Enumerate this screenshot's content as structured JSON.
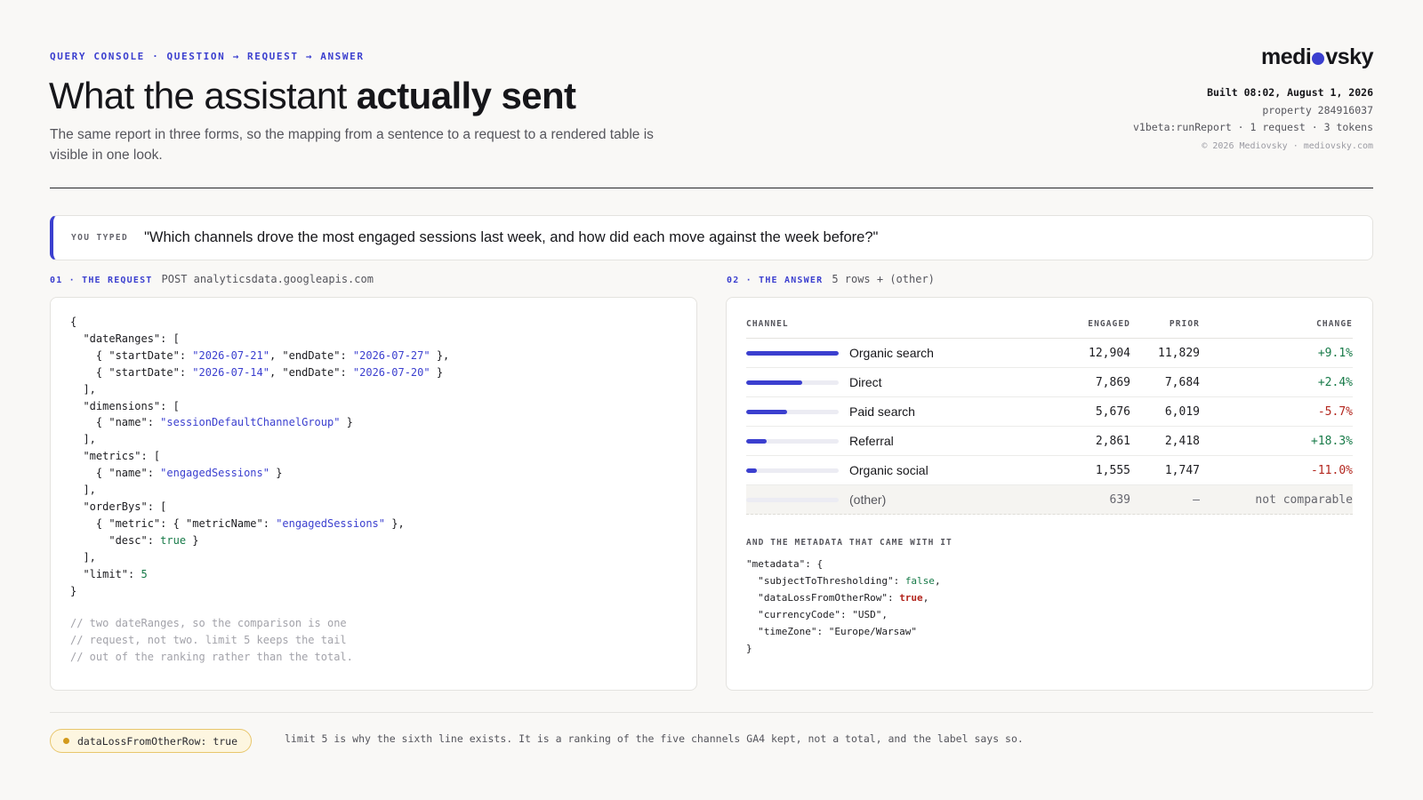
{
  "header": {
    "eyebrow": "QUERY CONSOLE · QUESTION → REQUEST → ANSWER",
    "title_plain": "What the assistant ",
    "title_bold": "actually sent",
    "subtitle": "The same report in three forms, so the mapping from a sentence to a request to a rendered table is visible in one look.",
    "logo_left": "medi",
    "logo_right": "vsky",
    "built": "Built 08:02, August 1, 2026",
    "property": "property 284916037",
    "method": "v1beta:runReport · 1 request · 3 tokens",
    "copyright": "© 2026 Mediovsky · mediovsky.com"
  },
  "query": {
    "tag": "YOU TYPED",
    "text": "\"Which channels drove the most engaged sessions last week, and how did each move against the week before?\""
  },
  "request": {
    "label": "01 · THE REQUEST",
    "detail": "POST analyticsdata.googleapis.com",
    "comment": "// two dateRanges, so the comparison is one\n// request, not two. limit 5 keeps the tail\n// out of the ranking rather than the total."
  },
  "answer": {
    "label": "02 · THE ANSWER",
    "detail": "5 rows + (other)",
    "columns": {
      "channel": "CHANNEL",
      "engaged": "ENGAGED",
      "prior": "PRIOR",
      "change": "CHANGE"
    },
    "rows": [
      {
        "channel": "Organic search",
        "engaged": "12,904",
        "prior": "11,829",
        "change": "+9.1%",
        "share": 1.0,
        "dir": "pos"
      },
      {
        "channel": "Direct",
        "engaged": "7,869",
        "prior": "7,684",
        "change": "+2.4%",
        "share": 0.61,
        "dir": "pos"
      },
      {
        "channel": "Paid search",
        "engaged": "5,676",
        "prior": "6,019",
        "change": "-5.7%",
        "share": 0.44,
        "dir": "neg"
      },
      {
        "channel": "Referral",
        "engaged": "2,861",
        "prior": "2,418",
        "change": "+18.3%",
        "share": 0.22,
        "dir": "pos"
      },
      {
        "channel": "Organic social",
        "engaged": "1,555",
        "prior": "1,747",
        "change": "-11.0%",
        "share": 0.12,
        "dir": "neg"
      },
      {
        "channel": "(other)",
        "engaged": "639",
        "prior": "—",
        "change": "not comparable",
        "share": 0.0,
        "dir": "nc"
      }
    ],
    "metadata_title": "AND THE METADATA THAT CAME WITH IT"
  },
  "footer": {
    "pill": "dataLossFromOtherRow: true",
    "note": "limit 5 is why the sixth line exists. It is a ranking of the five channels GA4 kept, not a total, and the label says so."
  },
  "colors": {
    "accent": "#3b3fcf",
    "positive": "#177a48",
    "negative": "#b3261e",
    "warning": "#d39a1b"
  }
}
